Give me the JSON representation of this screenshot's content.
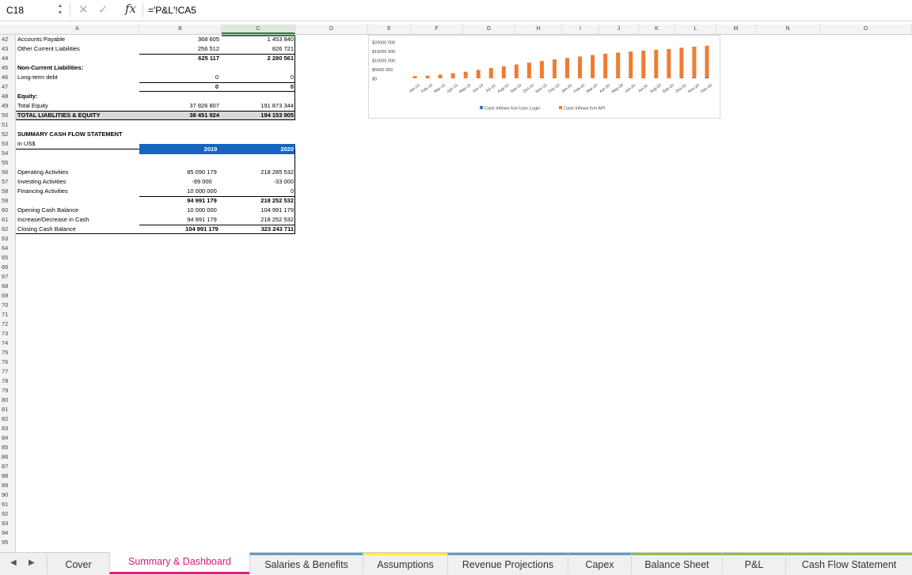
{
  "formula_bar": {
    "cell_ref": "C18",
    "formula": "='P&L'!CA5"
  },
  "columns": [
    "A",
    "B",
    "C",
    "D",
    "E",
    "F",
    "G",
    "H",
    "I",
    "J",
    "K",
    "L",
    "M",
    "N",
    "O"
  ],
  "balance_sheet": {
    "rows": [
      {
        "row": "42",
        "label": "Accounts Payable",
        "b": "368 605",
        "c": "1 453 840"
      },
      {
        "row": "43",
        "label": "Other Current Liabilities",
        "b": "256 512",
        "c": "826 721"
      },
      {
        "row": "44",
        "label": "",
        "b": "625 117",
        "c": "2 280 561"
      },
      {
        "row": "45",
        "label": "Non-Current Liabilities:",
        "b": "",
        "c": ""
      },
      {
        "row": "46",
        "label": "Long-term debt",
        "b": "0",
        "c": "0"
      },
      {
        "row": "47",
        "label": "",
        "b": "0",
        "c": "0"
      },
      {
        "row": "48",
        "label": "Equity:",
        "b": "",
        "c": ""
      },
      {
        "row": "49",
        "label": "Total Equity",
        "b": "37 826 807",
        "c": "191 873 344"
      },
      {
        "row": "50",
        "label": "TOTAL LIABLITIES & EQUITY",
        "b": "38 451 924",
        "c": "194 153 905"
      }
    ]
  },
  "cash_flow": {
    "title": "SUMMARY CASH FLOW STATEMENT",
    "currency": "in US$",
    "year_b": "2019",
    "year_c": "2020",
    "rows": [
      {
        "row": "56",
        "label": "Operating Activities",
        "b": "85 090 179",
        "c": "218 285 532"
      },
      {
        "row": "57",
        "label": "Investing Activities",
        "b": "-99 000",
        "c": "-33 000"
      },
      {
        "row": "58",
        "label": "Financing Activities",
        "b": "10 000 000",
        "c": "0"
      },
      {
        "row": "59",
        "label": "",
        "b": "94 991 179",
        "c": "218 252 532"
      },
      {
        "row": "60",
        "label": "Opening Cash Balance",
        "b": "10 000 000",
        "c": "104 991 179"
      },
      {
        "row": "61",
        "label": "Increase/Decrease in Cash",
        "b": "94 991 179",
        "c": "218 252 532"
      },
      {
        "row": "62",
        "label": "Closing Cash Balance",
        "b": "104 991 179",
        "c": "323 243 711"
      }
    ]
  },
  "empty_rows": [
    "51",
    "52",
    "53",
    "54",
    "55",
    "63",
    "64",
    "65",
    "66",
    "67",
    "68",
    "69",
    "70",
    "71",
    "72",
    "73",
    "74",
    "75",
    "76",
    "77",
    "78",
    "79",
    "80",
    "81",
    "82",
    "83",
    "84",
    "85",
    "86",
    "87",
    "88",
    "89",
    "90",
    "91",
    "92",
    "93",
    "94",
    "95"
  ],
  "chart_data": {
    "type": "bar",
    "stacked": true,
    "categories": [
      "Jan-19",
      "Feb-19",
      "Mar-19",
      "Apr-19",
      "May-19",
      "Jun-19",
      "Jul-19",
      "Aug-19",
      "Sep-19",
      "Oct-19",
      "Nov-19",
      "Dec-19",
      "Jan-20",
      "Feb-20",
      "Mar-20",
      "Apr-20",
      "May-20",
      "Jun-20",
      "Jul-20",
      "Aug-20",
      "Sep-20",
      "Oct-20",
      "Nov-20",
      "Dec-20"
    ],
    "y_ticks": [
      "$20000 000",
      "$15000 000",
      "$10000 000",
      "$5000 000",
      "$0"
    ],
    "ylim": [
      0,
      20000000
    ],
    "series": [
      {
        "name": "Cash Inflows fom User Login",
        "color": "#4472c4",
        "values": [
          0,
          0,
          0,
          0,
          0,
          0,
          0,
          0,
          0,
          0,
          0,
          0,
          0,
          0,
          0,
          0,
          0,
          0,
          0,
          0,
          0,
          300000,
          500000,
          600000
        ]
      },
      {
        "name": "Cash Inflows fom API",
        "color": "#ed7d31",
        "values": [
          1200000,
          1400000,
          2000000,
          2800000,
          3600000,
          4600000,
          5600000,
          6600000,
          7600000,
          8600000,
          9500000,
          10400000,
          11200000,
          12000000,
          12800000,
          13500000,
          14100000,
          14700000,
          15200000,
          15700000,
          16100000,
          16500000,
          16900000,
          17300000
        ]
      }
    ],
    "legend_position": "bottom"
  },
  "sheet_tabs": [
    {
      "label": "Cover",
      "color": ""
    },
    {
      "label": "Summary & Dashboard",
      "color": "#e0187a",
      "active": true
    },
    {
      "label": "Salaries & Benefits",
      "color": "#5b9bd5"
    },
    {
      "label": "Assumptions",
      "color": "#ffeb3b"
    },
    {
      "label": "Revenue Projections",
      "color": "#5b9bd5"
    },
    {
      "label": "Capex",
      "color": "#5b9bd5"
    },
    {
      "label": "Balance Sheet",
      "color": "#8bc34a"
    },
    {
      "label": "P&L",
      "color": "#8bc34a"
    },
    {
      "label": "Cash Flow Statement",
      "color": "#8bc34a"
    }
  ]
}
